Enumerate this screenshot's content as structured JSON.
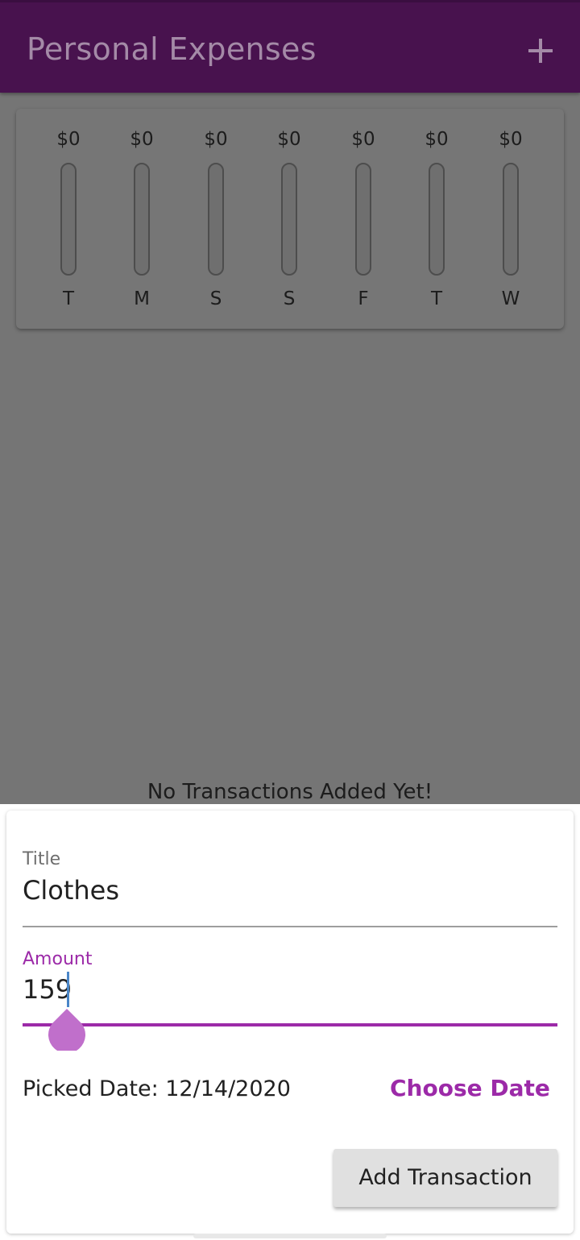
{
  "appbar": {
    "title": "Personal Expenses",
    "add_icon": "plus-icon"
  },
  "chart": {
    "bars": [
      {
        "day": "T",
        "amount": "$0",
        "spend_fraction": 0
      },
      {
        "day": "M",
        "amount": "$0",
        "spend_fraction": 0
      },
      {
        "day": "S",
        "amount": "$0",
        "spend_fraction": 0
      },
      {
        "day": "S",
        "amount": "$0",
        "spend_fraction": 0
      },
      {
        "day": "F",
        "amount": "$0",
        "spend_fraction": 0
      },
      {
        "day": "T",
        "amount": "$0",
        "spend_fraction": 0
      },
      {
        "day": "W",
        "amount": "$0",
        "spend_fraction": 0
      }
    ]
  },
  "transactions": {
    "empty_message": "No Transactions Added Yet!"
  },
  "form": {
    "title_label": "Title",
    "title_value": "Clothes",
    "amount_label": "Amount",
    "amount_value": "159",
    "picked_date": "Picked Date: 12/14/2020",
    "choose_date_label": "Choose Date",
    "submit_label": "Add Transaction"
  },
  "colors": {
    "appbar": "#48124e",
    "accent": "#9c2aa8",
    "overlay": "#757575"
  }
}
